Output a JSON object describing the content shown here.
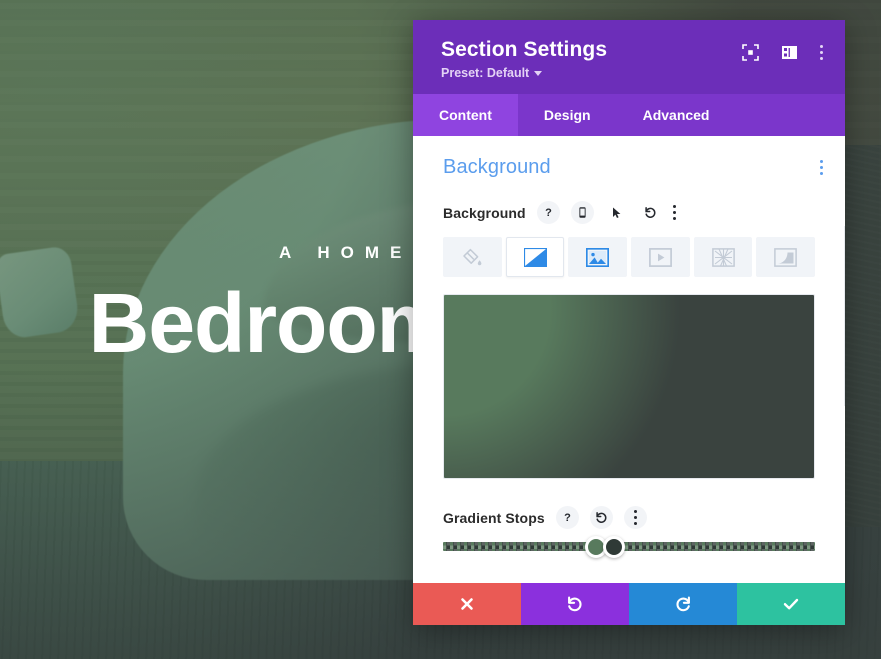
{
  "page_background": {
    "hero_eyebrow": "A  HOME  FOR  REST",
    "hero_title": "Bedroom Comfort",
    "overlay_description": "green radial gradient overlay on bedroom photo"
  },
  "modal": {
    "title": "Section Settings",
    "preset_label": "Preset: Default",
    "header_icons": [
      {
        "name": "fullscreen-focus-icon",
        "label": "Focus"
      },
      {
        "name": "layout-panel-icon",
        "label": "Layout"
      },
      {
        "name": "more-options-icon",
        "label": "More Options"
      }
    ],
    "tabs": [
      {
        "label": "Content",
        "active": true
      },
      {
        "label": "Design",
        "active": false
      },
      {
        "label": "Advanced",
        "active": false
      }
    ],
    "section": {
      "title": "Background",
      "accent_color": "#5b9ded",
      "menu_icon": "more-options-icon"
    },
    "background_field": {
      "label": "Background",
      "icons": [
        {
          "name": "help-icon",
          "glyph": "?"
        },
        {
          "name": "responsive-mobile-icon",
          "glyph": "mobile"
        },
        {
          "name": "hover-cursor-icon",
          "glyph": "cursor"
        },
        {
          "name": "reset-icon",
          "glyph": "undo"
        },
        {
          "name": "more-options-icon",
          "glyph": "kebab"
        }
      ],
      "types": [
        {
          "name": "background-color",
          "label": "Color",
          "active": false
        },
        {
          "name": "background-gradient",
          "label": "Gradient",
          "active": true
        },
        {
          "name": "background-image",
          "label": "Image",
          "active": false
        },
        {
          "name": "background-video",
          "label": "Video",
          "active": false
        },
        {
          "name": "background-pattern",
          "label": "Pattern",
          "active": false
        },
        {
          "name": "background-mask",
          "label": "Mask",
          "active": false
        }
      ]
    },
    "gradient_preview": {
      "type": "radial",
      "start_color": "#587a5d",
      "end_color": "#3a433f",
      "center": "0% 8%"
    },
    "gradient_stops": {
      "label": "Gradient Stops",
      "icons": [
        {
          "name": "help-icon",
          "glyph": "?"
        },
        {
          "name": "reset-icon",
          "glyph": "undo"
        },
        {
          "name": "more-options-icon",
          "glyph": "kebab"
        }
      ],
      "stops": [
        {
          "position_percent": 41,
          "color": "#587a5d"
        },
        {
          "position_percent": 46,
          "color": "#2f3a36"
        }
      ],
      "track_left_color": "#587a5d",
      "track_right_color": "#2f3a36"
    },
    "footer_buttons": [
      {
        "name": "cancel-button",
        "icon": "close-icon",
        "color": "#ea5a55",
        "label": "Cancel"
      },
      {
        "name": "undo-button",
        "icon": "undo-icon",
        "color": "#8b30dd",
        "label": "Undo"
      },
      {
        "name": "redo-button",
        "icon": "redo-icon",
        "color": "#2589d6",
        "label": "Redo"
      },
      {
        "name": "save-button",
        "icon": "check-icon",
        "color": "#2dc2a0",
        "label": "Save"
      }
    ]
  }
}
